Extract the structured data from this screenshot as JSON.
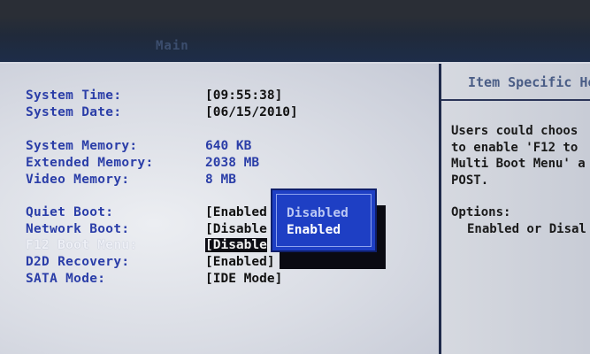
{
  "header": {
    "active_tab": "Main"
  },
  "fields": [
    {
      "label": "System Time:",
      "value": "[09:55:38]"
    },
    {
      "label": "System Date:",
      "value": "[06/15/2010]"
    },
    {
      "label": "System Memory:",
      "value": "640 KB"
    },
    {
      "label": "Extended Memory:",
      "value": "2038 MB"
    },
    {
      "label": "Video Memory:",
      "value": "8 MB"
    },
    {
      "label": "Quiet Boot:",
      "value": "[Enabled"
    },
    {
      "label": "Network Boot:",
      "value": "[Disable"
    },
    {
      "label": "F12 Boot Menu:",
      "value": "[Disable"
    },
    {
      "label": "D2D Recovery:",
      "value": "[Enabled]"
    },
    {
      "label": "SATA Mode:",
      "value": "[IDE Mode]"
    }
  ],
  "popup": {
    "options": [
      "Disabled",
      "Enabled"
    ],
    "selected": "Enabled"
  },
  "side": {
    "title": "Item Specific Hel",
    "help_lines": [
      "Users could choos",
      "to enable 'F12 to",
      "Multi Boot Menu' a",
      "POST."
    ],
    "options_label": "Options:",
    "options_text": "Enabled or Disal"
  },
  "colors": {
    "label_blue": "#2b3ea8",
    "popup_blue": "#1e3fc4",
    "background": "#d9dce4"
  }
}
